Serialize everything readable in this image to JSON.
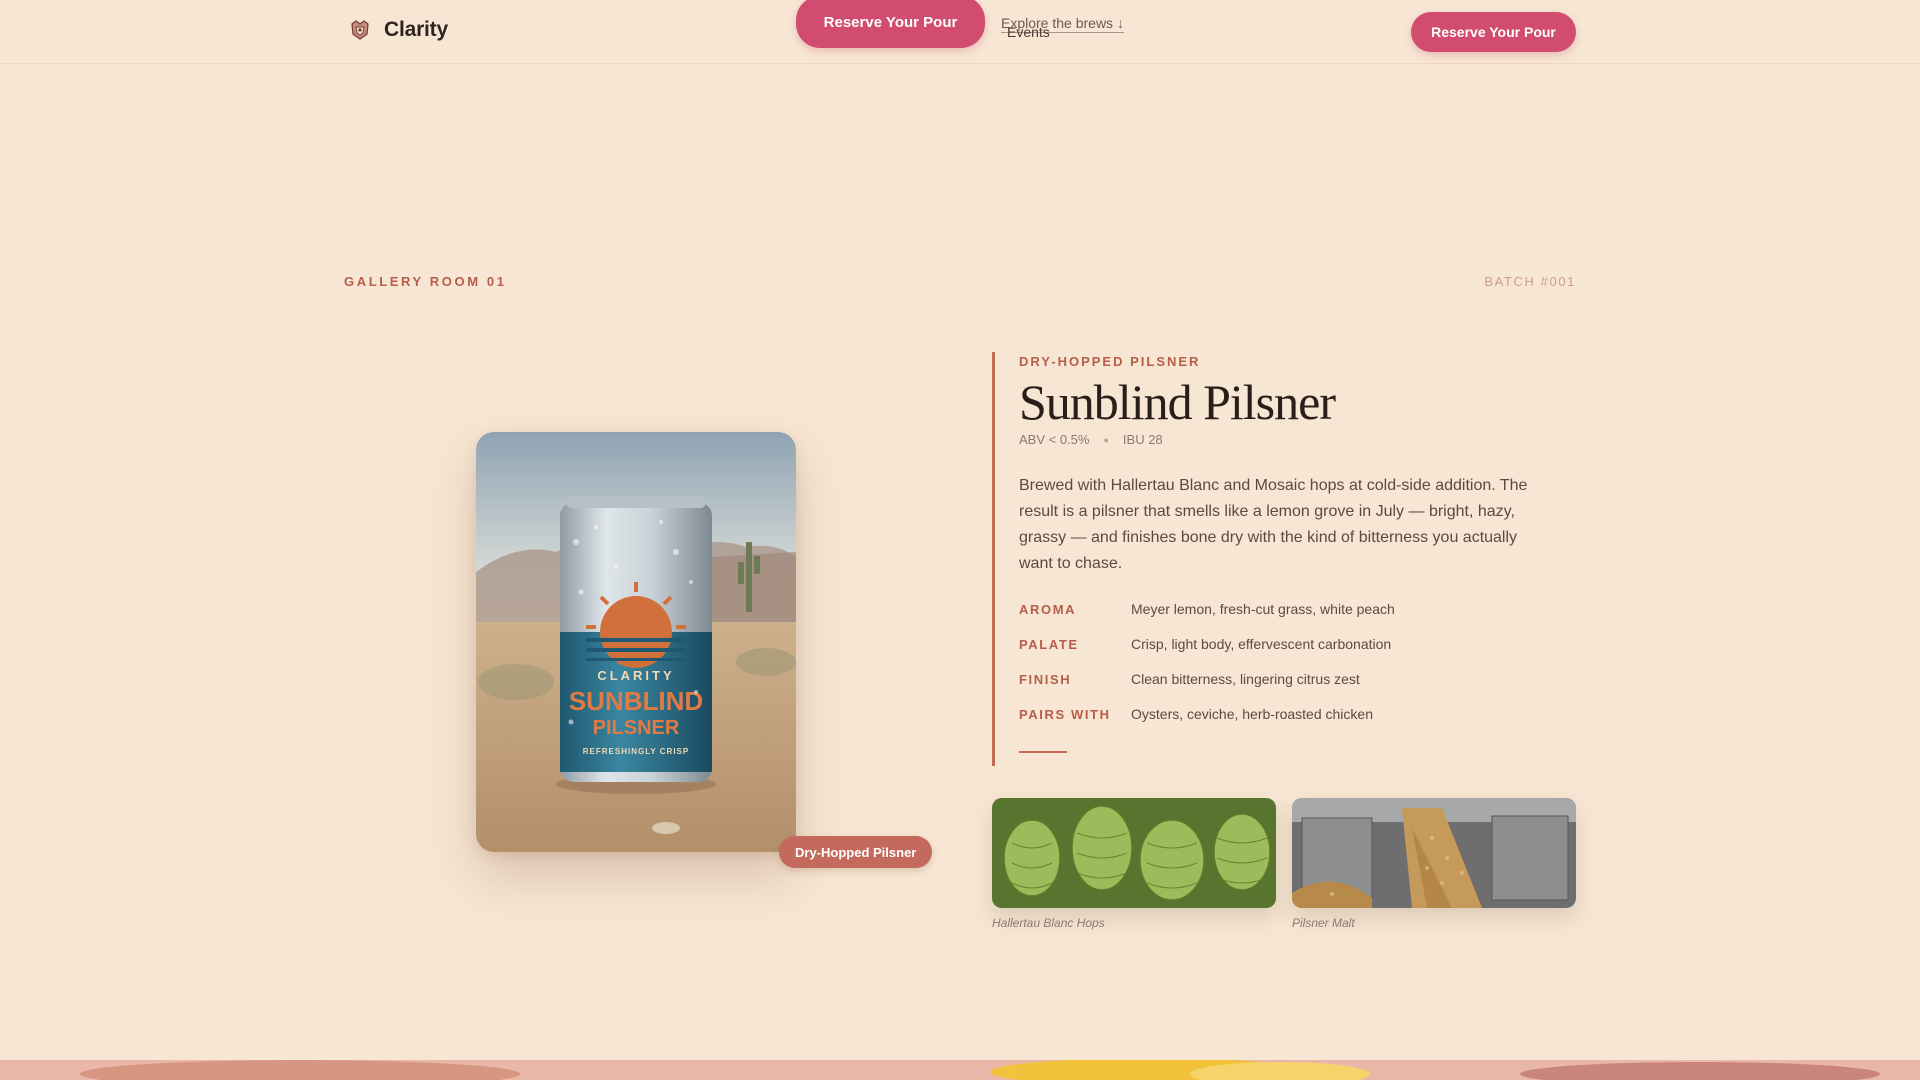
{
  "nav": {
    "brand_name": "Clarity",
    "brand_icon": "crest-icon",
    "hero_cta_label": "Reserve Your Pour",
    "explore_link": "Explore the brews ↓",
    "events_link": "Events",
    "cta_label": "Reserve Your Pour"
  },
  "section": {
    "room_label": "GALLERY ROOM 01",
    "batch_label": "BATCH #001"
  },
  "product": {
    "style_badge": "Dry-Hopped Pilsner",
    "can_brand": "CLARITY",
    "can_line1": "SUNBLIND",
    "can_line2": "PILSNER",
    "can_tagline": "REFRESHINGLY CRISP",
    "eyebrow": "DRY-HOPPED PILSNER",
    "title": "Sunblind Pilsner",
    "abv": "ABV < 0.5%",
    "ibu": "IBU 28",
    "description": "Brewed with Hallertau Blanc and Mosaic hops at cold-side addition. The result is a pilsner that smells like a lemon grove in July — bright, hazy, grassy — and finishes bone dry with the kind of bitterness you actually want to chase.",
    "notes": [
      {
        "key": "AROMA",
        "value": "Meyer lemon, fresh-cut grass, white peach"
      },
      {
        "key": "PALATE",
        "value": "Crisp, light body, effervescent carbonation"
      },
      {
        "key": "FINISH",
        "value": "Clean bitterness, lingering citrus zest"
      },
      {
        "key": "PAIRS WITH",
        "value": "Oysters, ceviche, herb-roasted chicken"
      }
    ]
  },
  "ingredients": [
    {
      "caption": "Hallertau Blanc Hops"
    },
    {
      "caption": "Pilsner Malt"
    }
  ],
  "colors": {
    "background": "#f7e6d3",
    "accent": "#d14c6e",
    "terracotta": "#b65e49"
  }
}
